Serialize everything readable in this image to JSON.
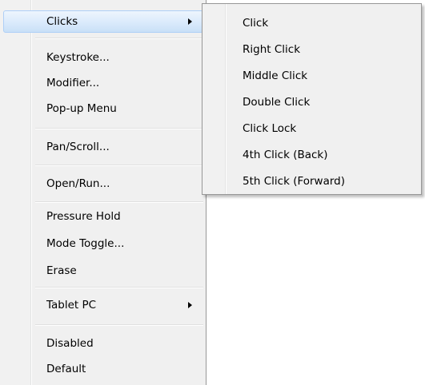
{
  "menu": {
    "items": [
      {
        "label": "Clicks",
        "submenu": true,
        "selected": true
      },
      {
        "label": "Keystroke..."
      },
      {
        "label": "Modifier..."
      },
      {
        "label": "Pop-up Menu"
      },
      {
        "label": "Pan/Scroll..."
      },
      {
        "label": "Open/Run..."
      },
      {
        "label": "Pressure Hold"
      },
      {
        "label": "Mode Toggle..."
      },
      {
        "label": "Erase"
      },
      {
        "label": "Tablet PC",
        "submenu": true
      },
      {
        "label": "Disabled"
      },
      {
        "label": "Default"
      }
    ]
  },
  "submenu": {
    "items": [
      {
        "label": "Click"
      },
      {
        "label": "Right Click"
      },
      {
        "label": "Middle Click"
      },
      {
        "label": "Double Click"
      },
      {
        "label": "Click Lock"
      },
      {
        "label": "4th Click (Back)"
      },
      {
        "label": "5th Click (Forward)"
      }
    ]
  },
  "colors": {
    "menu_background": "#f0f0f0",
    "selected_highlight": "#dcebfc",
    "selected_border": "#aecff7",
    "text": "#000000",
    "border": "#979797"
  }
}
